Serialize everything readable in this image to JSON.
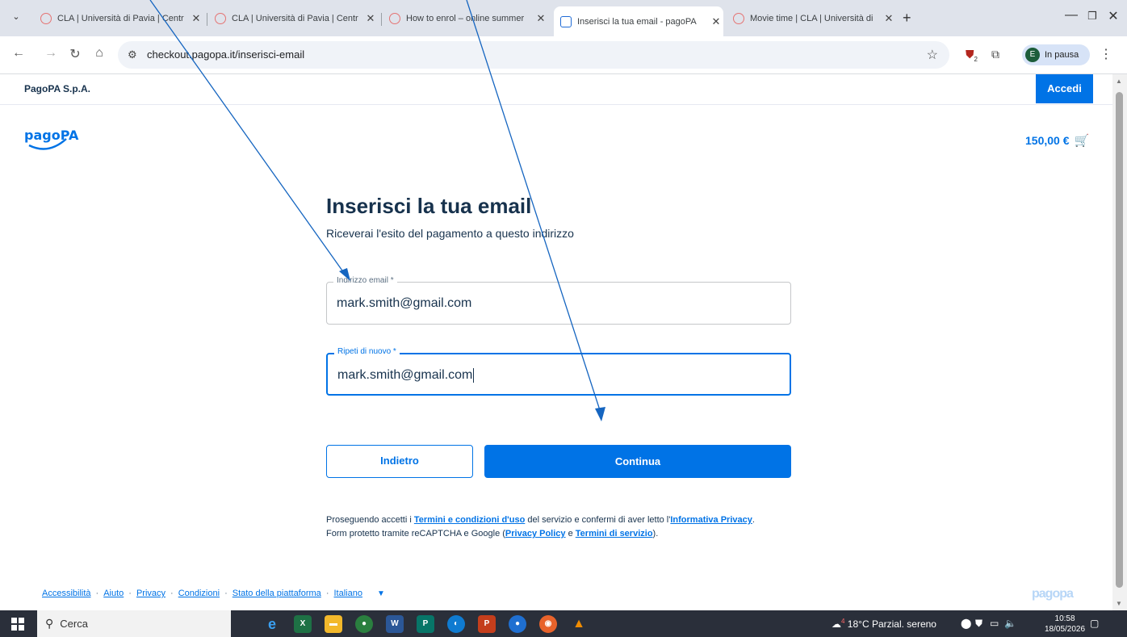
{
  "browser": {
    "tabs": [
      {
        "title": "CLA | Università di Pavia | Centr",
        "active": false
      },
      {
        "title": "CLA | Università di Pavia | Centr",
        "active": false
      },
      {
        "title": "How to enrol – online summer",
        "active": false
      },
      {
        "title": "Inserisci la tua email - pagoPA",
        "active": true
      },
      {
        "title": "Movie time | CLA | Università di",
        "active": false
      }
    ],
    "new_tab": "+",
    "url": "checkout.pagopa.it/inserisci-email",
    "profile_initial": "E",
    "profile_label": "In pausa",
    "extension_badge": "2"
  },
  "page": {
    "org_name": "PagoPA S.p.A.",
    "login_label": "Accedi",
    "logo_text": "pagoPA",
    "cart_amount": "150,00 €",
    "title": "Inserisci la tua email",
    "subtitle": "Riceverai l'esito del pagamento a questo indirizzo",
    "email_label": "Indirizzo email *",
    "email_value": "mark.smith@gmail.com",
    "repeat_label": "Ripeti di nuovo *",
    "repeat_value": "mark.smith@gmail.com",
    "back_label": "Indietro",
    "continue_label": "Continua",
    "legal": {
      "l1_a": "Proseguendo accetti i ",
      "l1_link1": "Termini e condizioni d'uso",
      "l1_b": " del servizio e confermi di aver letto l'",
      "l1_link2": "Informativa Privacy",
      "l1_c": ".",
      "l2_a": "Form protetto tramite reCAPTCHA e Google (",
      "l2_link1": "Privacy Policy",
      "l2_b": " e ",
      "l2_link2": "Termini di servizio",
      "l2_c": ")."
    },
    "footer_links": [
      "Accessibilità",
      "Aiuto",
      "Privacy",
      "Condizioni",
      "Stato della piattaforma",
      "Italiano"
    ],
    "footer_logo": "pagopa"
  },
  "taskbar": {
    "search_placeholder": "Cerca",
    "weather": "18°C  Parzial. sereno",
    "weather_badge": "4",
    "time": "10:58",
    "date": "18/05/2026"
  },
  "colors": {
    "accent": "#0073e6",
    "text": "#17324d",
    "annotation_arrow": "#1565c0"
  }
}
